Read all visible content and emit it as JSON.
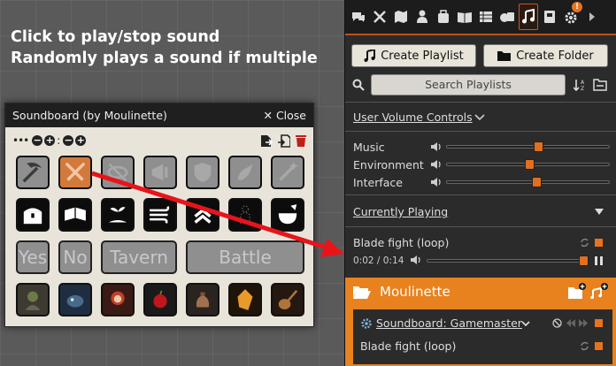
{
  "caption": {
    "line1": "Click to play/stop sound",
    "line2": "Randomly plays a sound if multiple"
  },
  "soundboard": {
    "title": "Soundboard (by Moulinette)",
    "close_label": "Close",
    "toolbar_dots": "•••",
    "text_buttons": [
      "Yes",
      "No",
      "Tavern",
      "Battle"
    ]
  },
  "sidebar": {
    "tabs": [
      "chat-icon",
      "combat-icon",
      "scenes-icon",
      "actors-icon",
      "items-icon",
      "journal-icon",
      "tables-icon",
      "cards-icon",
      "playlists-icon",
      "compendium-icon",
      "settings-icon",
      "collapse-icon"
    ],
    "active_tab": "playlists-icon",
    "settings_badge": "!",
    "create_playlist_label": "Create Playlist",
    "create_folder_label": "Create Folder",
    "search_placeholder": "Search Playlists",
    "volume_controls_label": "User Volume Controls",
    "volume": [
      {
        "label": "Music",
        "level": 0.56
      },
      {
        "label": "Environment",
        "level": 0.51
      },
      {
        "label": "Interface",
        "level": 0.55
      }
    ],
    "currently_playing_label": "Currently Playing",
    "now_playing": {
      "title": "Blade fight (loop)",
      "time": "0:02 / 0:14",
      "progress": 0.97
    },
    "folder_name": "Moulinette",
    "playlist_name": "Soundboard: Gamemaster",
    "playlist_track": "Blade fight (loop)"
  },
  "colors": {
    "accent": "#e8821e",
    "knob": "#e06f1e",
    "active_cell": "#d27a3c"
  }
}
